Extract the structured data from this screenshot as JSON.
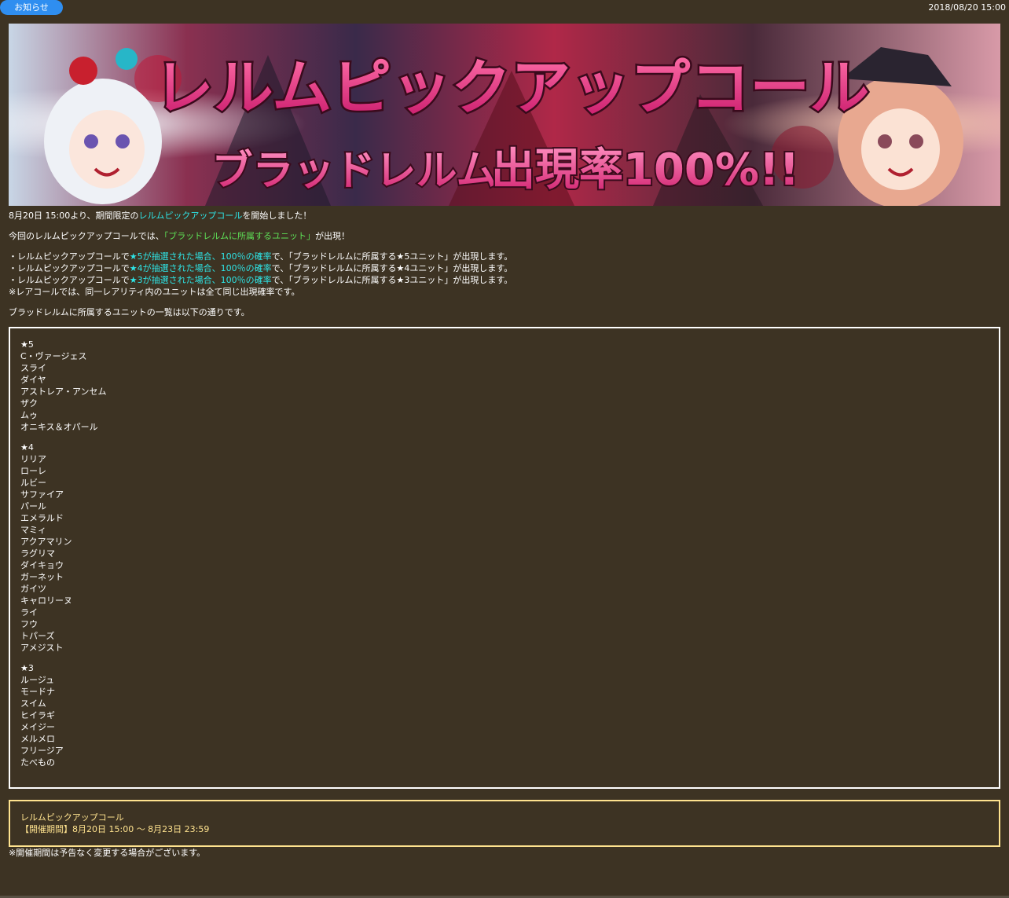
{
  "header": {
    "tag_label": "お知らせ",
    "date": "2018/08/20 15:00"
  },
  "banner": {
    "title": "レルムピックアップコール",
    "subtitle_left": "ブラッドレルム",
    "subtitle_right": "出現率100%!!"
  },
  "intro": {
    "line1_prefix": "8月20日 15:00より、期間限定の",
    "line1_link": "レルムピックアップコール",
    "line1_suffix": "を開始しました！",
    "line2_prefix": "今回のレルムピックアップコールでは、",
    "line2_highlight": "「ブラッドレルムに所属するユニット」",
    "line2_suffix": "が出現！"
  },
  "rates": [
    {
      "prefix": "・レルムピックアップコールで",
      "highlight": "★5が抽選された場合、100％の確率",
      "suffix": "で、「ブラッドレルムに所属する★5ユニット」が出現します。"
    },
    {
      "prefix": "・レルムピックアップコールで",
      "highlight": "★4が抽選された場合、100％の確率",
      "suffix": "で、「ブラッドレルムに所属する★4ユニット」が出現します。"
    },
    {
      "prefix": "・レルムピックアップコールで",
      "highlight": "★3が抽選された場合、100％の確率",
      "suffix": "で、「ブラッドレルムに所属する★3ユニット」が出現します。"
    }
  ],
  "rates_note": "※レアコールでは、同一レアリティ内のユニットは全て同じ出現確率です。",
  "list_intro": "ブラッドレルムに所属するユニットの一覧は以下の通りです。",
  "unit_groups": [
    {
      "rarity": "★5",
      "units": [
        "C・ヴァージェス",
        "スライ",
        "ダイヤ",
        "アストレア・アンセム",
        "ザク",
        "ムゥ",
        "オニキス＆オパール"
      ]
    },
    {
      "rarity": "★4",
      "units": [
        "リリア",
        "ローレ",
        "ルビー",
        "サファイア",
        "パール",
        "エメラルド",
        "マミィ",
        "アクアマリン",
        "ラグリマ",
        "ダイキョウ",
        "ガーネット",
        "ガイツ",
        "キャロリーヌ",
        "ライ",
        "フウ",
        "トパーズ",
        "アメジスト"
      ]
    },
    {
      "rarity": "★3",
      "units": [
        "ルージュ",
        "モードナ",
        "スイム",
        "ヒイラギ",
        "メイジー",
        "メルメロ",
        "フリージア",
        "たべもの"
      ]
    }
  ],
  "event": {
    "name": "レルムピックアップコール",
    "period": "【開催期間】8月20日 15:00 ～ 8月23日 23:59"
  },
  "footnote": "※開催期間は予告なく変更する場合がございます。",
  "colors": {
    "background": "#3d3323",
    "cyan": "#2ee4e6",
    "green": "#5ee057",
    "yellow": "#ffe38f",
    "tag": "#2f8ef0"
  }
}
